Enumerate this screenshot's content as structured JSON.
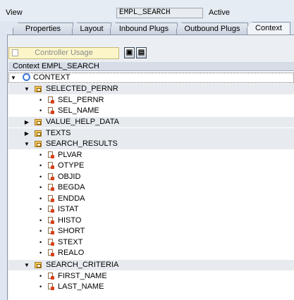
{
  "header": {
    "view_label": "View",
    "view_name": "EMPL_SEARCH",
    "status": "Active"
  },
  "tabs": [
    {
      "label": "Properties",
      "active": false
    },
    {
      "label": "Layout",
      "active": false
    },
    {
      "label": "Inbound Plugs",
      "active": false
    },
    {
      "label": "Outbound Plugs",
      "active": false
    },
    {
      "label": "Context",
      "active": true
    }
  ],
  "toolbar": {
    "controller_usage_label": "Controller Usage",
    "icons": [
      "binoculars-icon",
      "binoculars-next-icon"
    ]
  },
  "tree": {
    "header": "Context EMPL_SEARCH",
    "nodes": [
      {
        "label": "CONTEXT",
        "kind": "root"
      },
      {
        "label": "SELECTED_PERNR",
        "kind": "node",
        "expanded": true
      },
      {
        "label": "SEL_PERNR",
        "kind": "attr"
      },
      {
        "label": "SEL_NAME",
        "kind": "attr"
      },
      {
        "label": "VALUE_HELP_DATA",
        "kind": "node",
        "expanded": false
      },
      {
        "label": "TEXTS",
        "kind": "node",
        "expanded": false
      },
      {
        "label": "SEARCH_RESULTS",
        "kind": "node",
        "expanded": true
      },
      {
        "label": "PLVAR",
        "kind": "attr"
      },
      {
        "label": "OTYPE",
        "kind": "attr"
      },
      {
        "label": "OBJID",
        "kind": "attr"
      },
      {
        "label": "BEGDA",
        "kind": "attr"
      },
      {
        "label": "ENDDA",
        "kind": "attr"
      },
      {
        "label": "ISTAT",
        "kind": "attr"
      },
      {
        "label": "HISTO",
        "kind": "attr"
      },
      {
        "label": "SHORT",
        "kind": "attr"
      },
      {
        "label": "STEXT",
        "kind": "attr"
      },
      {
        "label": "REALO",
        "kind": "attr"
      },
      {
        "label": "SEARCH_CRITERIA",
        "kind": "node",
        "expanded": true
      },
      {
        "label": "FIRST_NAME",
        "kind": "attr"
      },
      {
        "label": "LAST_NAME",
        "kind": "attr"
      }
    ]
  },
  "colors": {
    "background": "#dfe6ef",
    "tree_bg": "#ffffff",
    "group_row": "#e7ebf0",
    "node_icon": "#f3c862",
    "attr_marker": "#d9421c",
    "root_icon": "#3c78d8"
  }
}
